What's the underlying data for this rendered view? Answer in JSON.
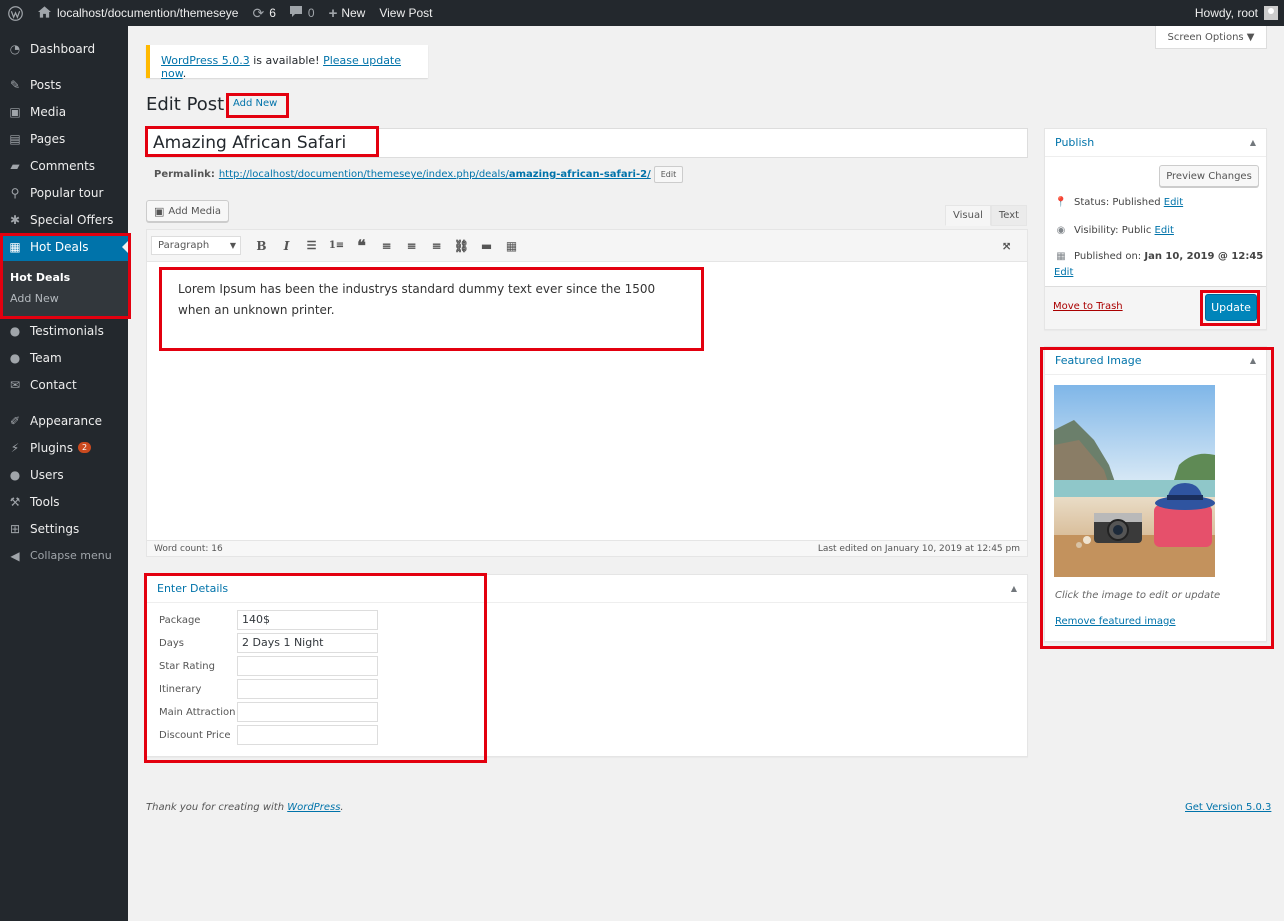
{
  "adminbar": {
    "site_url": "localhost/documention/themeseye",
    "updates_count": "6",
    "comments_count": "0",
    "new_label": "New",
    "view_post_label": "View Post",
    "howdy": "Howdy, root"
  },
  "menu": {
    "items": [
      {
        "label": "Dashboard",
        "icon": "dashboard-icon"
      },
      {
        "label": "Posts",
        "icon": "pin-icon"
      },
      {
        "label": "Media",
        "icon": "media-icon"
      },
      {
        "label": "Pages",
        "icon": "page-icon"
      },
      {
        "label": "Comments",
        "icon": "comment-icon"
      },
      {
        "label": "Popular tour",
        "icon": "location-icon"
      },
      {
        "label": "Special Offers",
        "icon": "palm-icon"
      },
      {
        "label": "Hot Deals",
        "icon": "chart-icon"
      },
      {
        "label": "Testimonials",
        "icon": "user-icon"
      },
      {
        "label": "Team",
        "icon": "user-icon"
      },
      {
        "label": "Contact",
        "icon": "mail-icon"
      },
      {
        "label": "Appearance",
        "icon": "brush-icon"
      },
      {
        "label": "Plugins",
        "icon": "plugin-icon"
      },
      {
        "label": "Users",
        "icon": "user-icon"
      },
      {
        "label": "Tools",
        "icon": "wrench-icon"
      },
      {
        "label": "Settings",
        "icon": "settings-icon"
      }
    ],
    "plugins_badge": "2",
    "submenu": [
      "Hot Deals",
      "Add New"
    ],
    "collapse_label": "Collapse menu"
  },
  "notice": {
    "version_link": "WordPress 5.0.3",
    "middle_text": " is available! ",
    "update_link": "Please update now",
    "end_text": "."
  },
  "screen_options": "Screen Options ▼",
  "page": {
    "title": "Edit Post",
    "add_new": "Add New"
  },
  "post": {
    "title": "Amazing African Safari",
    "permalink_label": "Permalink:",
    "permalink_base": "http://localhost/documention/themeseye/index.php/deals/",
    "permalink_slug": "amazing-african-safari-2/",
    "permalink_edit": "Edit"
  },
  "editor": {
    "add_media": "Add Media",
    "tab_visual": "Visual",
    "tab_text": "Text",
    "format": "Paragraph",
    "content_line1": "Lorem Ipsum has been the industrys standard dummy text ever since the 1500",
    "content_line2": "when an unknown printer.",
    "word_count": "Word count: 16",
    "last_edited": "Last edited on January 10, 2019 at 12:45 pm"
  },
  "details": {
    "title": "Enter Details",
    "fields": [
      {
        "label": "Package",
        "value": "140$"
      },
      {
        "label": "Days",
        "value": "2 Days 1 Night"
      },
      {
        "label": "Star Rating",
        "value": ""
      },
      {
        "label": "Itinerary",
        "value": ""
      },
      {
        "label": "Main Attraction",
        "value": ""
      },
      {
        "label": "Discount Price",
        "value": ""
      }
    ]
  },
  "publish": {
    "title": "Publish",
    "preview": "Preview Changes",
    "status_label": "Status:",
    "status_value": "Published",
    "visibility_label": "Visibility:",
    "visibility_value": "Public",
    "published_label": "Published on:",
    "published_value": "Jan 10, 2019 @ 12:45",
    "edit": "Edit",
    "trash": "Move to Trash",
    "update": "Update"
  },
  "featured": {
    "title": "Featured Image",
    "hint": "Click the image to edit or update",
    "remove": "Remove featured image"
  },
  "footer": {
    "thanks": "Thank you for creating with ",
    "wp_link": "WordPress",
    "period": ".",
    "version": "Get Version 5.0.3"
  },
  "colors": {
    "accent": "#0073aa",
    "highlight": "#e3000f",
    "sidebar": "#23282d"
  }
}
